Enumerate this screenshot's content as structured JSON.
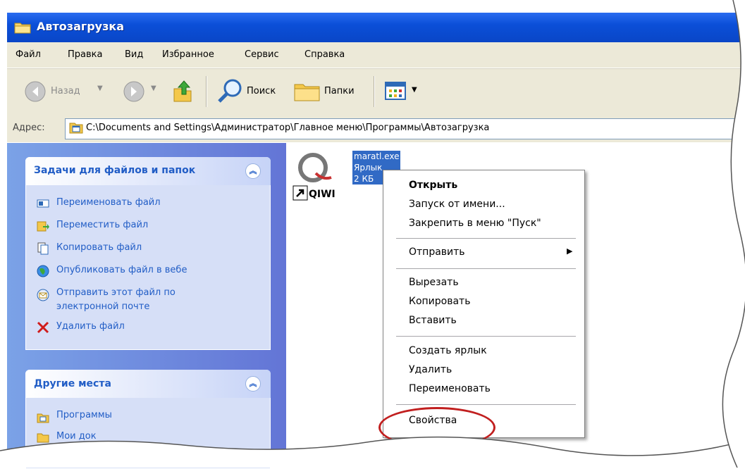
{
  "window": {
    "title": "Автозагрузка"
  },
  "menubar": {
    "items": [
      "Файл",
      "Правка",
      "Вид",
      "Избранное",
      "Сервис",
      "Справка"
    ]
  },
  "toolbar": {
    "back_label": "Назад",
    "search_label": "Поиск",
    "folders_label": "Папки"
  },
  "address": {
    "label": "Адрес:",
    "value": "C:\\Documents and Settings\\Администратор\\Главное меню\\Программы\\Автозагрузка"
  },
  "tasks_panel": {
    "title": "Задачи для файлов и папок",
    "items": [
      {
        "label": "Переименовать файл",
        "icon": "rename-icon"
      },
      {
        "label": "Переместить файл",
        "icon": "move-icon"
      },
      {
        "label": "Копировать файл",
        "icon": "copy-icon"
      },
      {
        "label": "Опубликовать файл в вебе",
        "icon": "publish-web-icon"
      },
      {
        "label": "Отправить этот файл по",
        "icon": "email-icon"
      },
      {
        "label": "электронной почте"
      },
      {
        "label": "Удалить файл",
        "icon": "delete-icon"
      }
    ]
  },
  "places_panel": {
    "title": "Другие места",
    "items": [
      {
        "label": "Программы",
        "icon": "programs-folder-icon"
      },
      {
        "label": "Мои док",
        "icon": "documents-icon"
      }
    ]
  },
  "file": {
    "name": "maratl.exe",
    "type": "Ярлык",
    "size": "2 КБ",
    "icon_text": "QIWI"
  },
  "context_menu": {
    "items": [
      {
        "label": "Открыть",
        "bold": true
      },
      {
        "label": "Запуск от имени..."
      },
      {
        "label": "Закрепить в меню \"Пуск\""
      },
      {
        "label": "Отправить",
        "submenu": true
      },
      {
        "label": "Вырезать"
      },
      {
        "label": "Копировать"
      },
      {
        "label": "Вставить"
      },
      {
        "label": "Создать ярлык"
      },
      {
        "label": "Удалить"
      },
      {
        "label": "Переименовать"
      },
      {
        "label": "Свойства",
        "highlighted_by_circle": true
      }
    ]
  },
  "colors": {
    "titlebar": "#0b4fd8",
    "menu_bg": "#ece9d8",
    "panel_title": "#215dc6",
    "selection": "#316ac5",
    "annotation_circle": "#c11f1f"
  }
}
